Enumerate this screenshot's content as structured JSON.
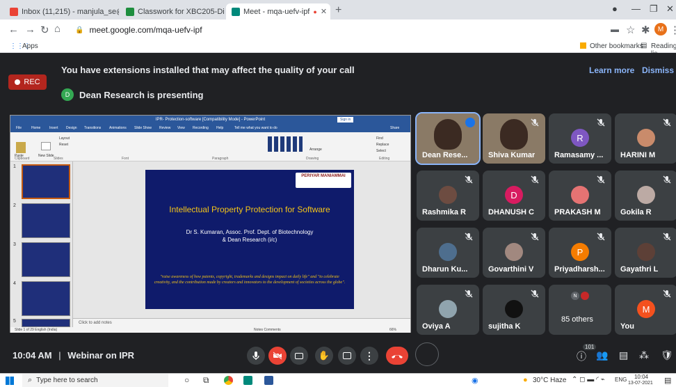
{
  "tabs": [
    {
      "title": "Inbox (11,215) - manjula_se@pm",
      "icon": "gmail-icon",
      "color": "#ea4335"
    },
    {
      "title": "Classwork for XBC205-Digital Ele",
      "icon": "classroom-icon",
      "color": "#1e8e3e"
    },
    {
      "title": "Meet - mqa-uefv-ipf",
      "icon": "meet-icon",
      "color": "#00897b"
    }
  ],
  "omnibox": {
    "url": "meet.google.com/mqa-uefv-ipf"
  },
  "profile_initial": "M",
  "bookmarks": {
    "apps": "Apps",
    "other": "Other bookmarks",
    "reading": "Reading lis"
  },
  "banner": {
    "extensions_msg": "You have extensions installed that may affect the quality of your call",
    "learn_more": "Learn more",
    "dismiss": "Dismiss",
    "rec": "REC",
    "presenter_initial": "D",
    "presenting": "Dean Research is presenting"
  },
  "presentation": {
    "window_title": "IPR- Protection-software [Compatibility Mode] - PowerPoint",
    "signin": "Sign in",
    "menu": [
      "File",
      "Home",
      "Insert",
      "Design",
      "Transitions",
      "Animations",
      "Slide Show",
      "Review",
      "View",
      "Recording",
      "Help",
      "Tell me what you want to do"
    ],
    "share": "Share",
    "ribbon_groups": [
      "Clipboard",
      "Slides",
      "Font",
      "Paragraph",
      "Drawing",
      "Editing"
    ],
    "ribbon_items": [
      "Paste",
      "New Slide",
      "Layout",
      "Reset",
      "Arrange",
      "Find",
      "Replace",
      "Select"
    ],
    "thumb_numbers": [
      "1",
      "2",
      "3",
      "4",
      "5"
    ],
    "slide_title": "Intellectual Property Protection for Software",
    "slide_author_line1": "Dr S. Kumaran, Assoc. Prof. Dept. of Biotechnology",
    "slide_author_line2": "& Dean Research (i/c)",
    "slide_quote": "\"raise awareness of how patents, copyright, trademarks and designs impact on daily life\" and \"to celebrate creativity, and the contribution made by creators and innovators to the development of societies across the globe\".",
    "slide_logo": "PERIYAR MANIAMMAI",
    "notes_placeholder": "Click to add notes",
    "status_left": "Slide 1 of 29     English (India)",
    "status_right": "Notes     Comments",
    "zoom": "66%"
  },
  "participants": [
    {
      "name": "Dean Rese...",
      "kind": "video",
      "speaking": true
    },
    {
      "name": "Shiva Kumar",
      "kind": "video",
      "muted": true
    },
    {
      "name": "Ramasamy ...",
      "kind": "initial",
      "initial": "R",
      "color": "#7e57c2",
      "muted": true
    },
    {
      "name": "HARINI M",
      "kind": "photo",
      "color": "#c98b6b",
      "muted": true
    },
    {
      "name": "Rashmika R",
      "kind": "photo",
      "color": "#6d4c41",
      "muted": true
    },
    {
      "name": "DHANUSH C",
      "kind": "initial",
      "initial": "D",
      "color": "#d81b60",
      "muted": true
    },
    {
      "name": "PRAKASH M",
      "kind": "photo",
      "color": "#e57373",
      "muted": true
    },
    {
      "name": "Gokila R",
      "kind": "photo",
      "color": "#bcaaa4",
      "muted": true
    },
    {
      "name": "Dharun Ku...",
      "kind": "photo",
      "color": "#4e6e8e",
      "muted": true
    },
    {
      "name": "Govarthini V",
      "kind": "photo",
      "color": "#a1887f",
      "muted": true
    },
    {
      "name": "Priyadharsh...",
      "kind": "initial",
      "initial": "P",
      "color": "#f57c00",
      "muted": true
    },
    {
      "name": "Gayathri L",
      "kind": "photo",
      "color": "#5d4037",
      "muted": true
    },
    {
      "name": "Oviya A",
      "kind": "photo",
      "color": "#90a4ae",
      "muted": true
    },
    {
      "name": "sujitha K",
      "kind": "photo",
      "color": "#111111",
      "muted": true
    },
    {
      "name": "85 others",
      "kind": "others",
      "initial": "N"
    },
    {
      "name": "You",
      "kind": "initial",
      "initial": "M",
      "color": "#f4511e",
      "muted": true
    }
  ],
  "bottom": {
    "time": "10:04 AM",
    "separator": "|",
    "meeting": "Webinar on IPR",
    "participant_count": "101"
  },
  "taskbar": {
    "search": "Type here to search",
    "weather": "30°C  Haze",
    "lang": "ENG",
    "clock_time": "10:04",
    "clock_date": "13-07-2021"
  }
}
